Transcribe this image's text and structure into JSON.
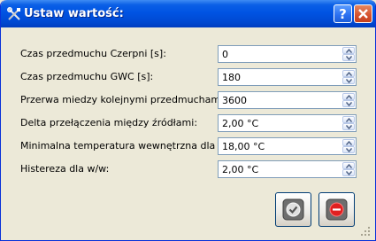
{
  "window": {
    "title": "Ustaw wartość:",
    "icons": {
      "app": "wrench-screwdriver-icon",
      "help": "question-icon",
      "close": "close-icon"
    }
  },
  "fields": [
    {
      "label": "Czas przedmuchu Czerpni [s]:",
      "value": "0"
    },
    {
      "label": "Czas przedmuchu GWC [s]:",
      "value": "180"
    },
    {
      "label": "Przerwa miedzy kolejnymi przedmuchami [s]:",
      "value": "3600"
    },
    {
      "label": "Delta przełączenia między źródłami:",
      "value": "2,00 °C"
    },
    {
      "label": "Minimalna temperatura wewnętrzna dla lata:",
      "value": "18,00 °C"
    },
    {
      "label": "Histereza dla w/w:",
      "value": "2,00 °C"
    }
  ],
  "buttons": {
    "ok": {
      "icon": "checkmark-icon"
    },
    "cancel": {
      "icon": "forbidden-icon",
      "color": "#e02020"
    }
  }
}
